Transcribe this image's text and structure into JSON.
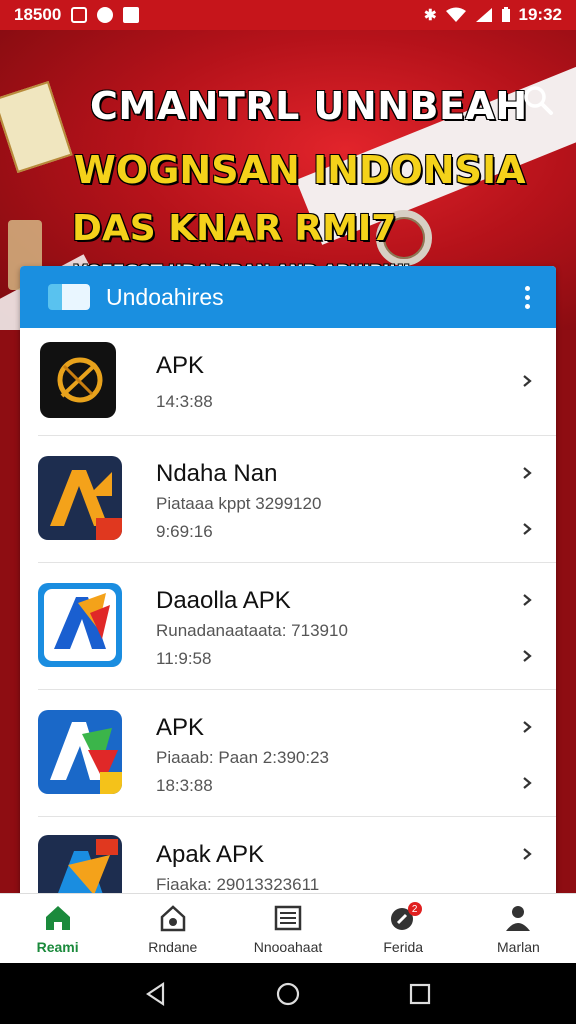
{
  "status_bar": {
    "time_left": "18500",
    "time_right": "19:32",
    "bluetooth": "bluetooth-icon",
    "wifi": "wifi-icon",
    "signal": "signal-icon",
    "battery": "battery-icon"
  },
  "banner": {
    "line1": "CMANTRL UNNBEAH",
    "line2": "WOGNSAN INDONSIA",
    "line3": "DAS KNAR RMI7",
    "line4": "VOEEGST UDADIBAN AND ARUIRIHI",
    "search_icon": "search-icon"
  },
  "list_header": {
    "title": "Undoahires",
    "menu_icon": "more-vertical-icon"
  },
  "apps": [
    {
      "name": "APK",
      "line1": "14:3:88",
      "line2": ""
    },
    {
      "name": "Ndaha Nan",
      "line1": "Piataaa kppt 3299120",
      "line2": "9:69:16"
    },
    {
      "name": "Daaolla APK",
      "line1": "Runadanaataata: 713910",
      "line2": "11:9:58"
    },
    {
      "name": "APK",
      "line1": "Piaaab: Paan 2:390:23",
      "line2": "18:3:88"
    },
    {
      "name": "Apak APK",
      "line1": "Fiaaka: 29013323611",
      "line2": ""
    }
  ],
  "bottom_nav": [
    {
      "label": "Reami",
      "icon": "home-icon",
      "active": true
    },
    {
      "label": "Rndane",
      "icon": "house-settings-icon",
      "active": false
    },
    {
      "label": "Nnooahaat",
      "icon": "newspaper-icon",
      "active": false
    },
    {
      "label": "Ferida",
      "icon": "rocket-icon",
      "active": false,
      "badge": "2"
    },
    {
      "label": "Marlan",
      "icon": "person-icon",
      "active": false
    }
  ],
  "system_nav": {
    "back": "back-icon",
    "home": "home-circle-icon",
    "recents": "recents-icon"
  }
}
